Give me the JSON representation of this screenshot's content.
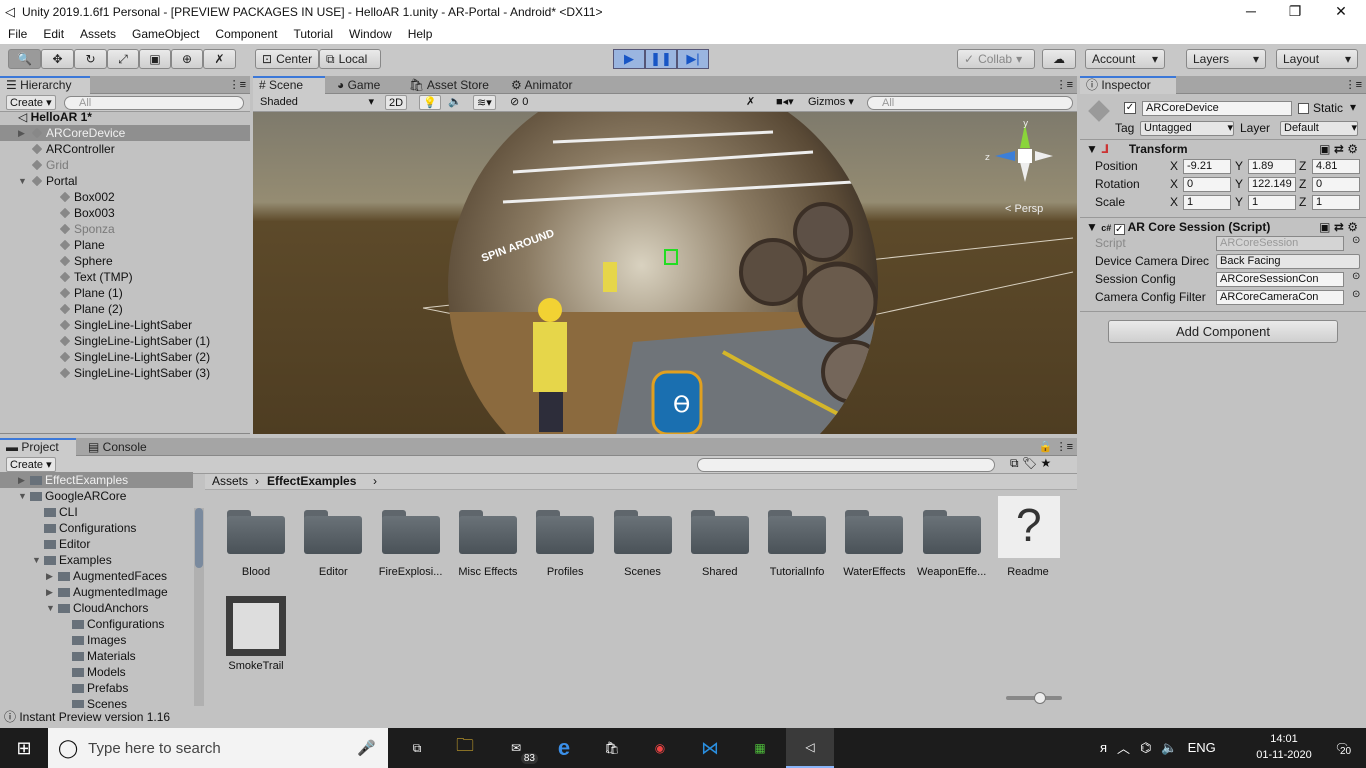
{
  "window": {
    "title": "Unity 2019.1.6f1 Personal - [PREVIEW PACKAGES IN USE] - HelloAR 1.unity - AR-Portal - Android* <DX11>"
  },
  "menu": [
    "File",
    "Edit",
    "Assets",
    "GameObject",
    "Component",
    "Tutorial",
    "Window",
    "Help"
  ],
  "toolbar": {
    "center": "Center",
    "local": "Local",
    "collab": "Collab",
    "account": "Account",
    "layers": "Layers",
    "layout": "Layout"
  },
  "hierarchy": {
    "tab": "Hierarchy",
    "create": "Create",
    "search_placeholder": "All",
    "scene": "HelloAR 1*",
    "items": [
      {
        "label": "ARCoreDevice",
        "level": 1,
        "selected": true
      },
      {
        "label": "ARController",
        "level": 1
      },
      {
        "label": "Grid",
        "level": 1,
        "dim": true
      },
      {
        "label": "Portal",
        "level": 1
      },
      {
        "label": "Box002",
        "level": 2
      },
      {
        "label": "Box003",
        "level": 2
      },
      {
        "label": "Sponza",
        "level": 2,
        "dim": true
      },
      {
        "label": "Plane",
        "level": 2
      },
      {
        "label": "Sphere",
        "level": 2
      },
      {
        "label": "Text (TMP)",
        "level": 2
      },
      {
        "label": "Plane (1)",
        "level": 2
      },
      {
        "label": "Plane (2)",
        "level": 2
      },
      {
        "label": "SingleLine-LightSaber",
        "level": 2
      },
      {
        "label": "SingleLine-LightSaber (1)",
        "level": 2
      },
      {
        "label": "SingleLine-LightSaber (2)",
        "level": 2
      },
      {
        "label": "SingleLine-LightSaber (3)",
        "level": 2
      }
    ]
  },
  "scene": {
    "tabs": [
      "Scene",
      "Game",
      "Asset Store",
      "Animator"
    ],
    "shading": "Shaded",
    "mode2d": "2D",
    "fx_count": "0",
    "gizmos": "Gizmos",
    "search_placeholder": "All",
    "persp": "Persp",
    "sign_text": "SPIN AROUND"
  },
  "inspector": {
    "tab": "Inspector",
    "object_name": "ARCoreDevice",
    "static": "Static",
    "tag_label": "Tag",
    "tag": "Untagged",
    "layer_label": "Layer",
    "layer": "Default",
    "transform": {
      "title": "Transform",
      "rows": [
        {
          "label": "Position",
          "x": "-9.21",
          "y": "1.89",
          "z": "4.81"
        },
        {
          "label": "Rotation",
          "x": "0",
          "y": "122.149",
          "z": "0"
        },
        {
          "label": "Scale",
          "x": "1",
          "y": "1",
          "z": "1"
        }
      ]
    },
    "script": {
      "title": "AR Core Session (Script)",
      "rows": [
        {
          "label": "Script",
          "value": "ARCoreSession"
        },
        {
          "label": "Device Camera Direc",
          "value": "Back Facing"
        },
        {
          "label": "Session Config",
          "value": "ARCoreSessionCon"
        },
        {
          "label": "Camera Config Filter",
          "value": "ARCoreCameraCon"
        }
      ]
    },
    "add_component": "Add Component"
  },
  "project": {
    "tabs": [
      "Project",
      "Console"
    ],
    "create": "Create",
    "tree": [
      {
        "label": "EffectExamples",
        "level": 1,
        "selected": true
      },
      {
        "label": "GoogleARCore",
        "level": 1
      },
      {
        "label": "CLI",
        "level": 2
      },
      {
        "label": "Configurations",
        "level": 2
      },
      {
        "label": "Editor",
        "level": 2
      },
      {
        "label": "Examples",
        "level": 2
      },
      {
        "label": "AugmentedFaces",
        "level": 3
      },
      {
        "label": "AugmentedImage",
        "level": 3
      },
      {
        "label": "CloudAnchors",
        "level": 3
      },
      {
        "label": "Configurations",
        "level": 4
      },
      {
        "label": "Images",
        "level": 4
      },
      {
        "label": "Materials",
        "level": 4
      },
      {
        "label": "Models",
        "level": 4
      },
      {
        "label": "Prefabs",
        "level": 4
      },
      {
        "label": "Scenes",
        "level": 4
      }
    ],
    "breadcrumb": [
      "Assets",
      "EffectExamples"
    ],
    "assets": [
      "Blood",
      "Editor",
      "FireExplosi...",
      "Misc Effects",
      "Profiles",
      "Scenes",
      "Shared",
      "TutorialInfo",
      "WaterEffects",
      "WeaponEffe..."
    ],
    "readme": "Readme",
    "smoke": "SmokeTrail"
  },
  "status": {
    "text": "Instant Preview version 1.16"
  },
  "taskbar": {
    "search_placeholder": "Type here to search",
    "mail_badge": "83",
    "lang": "ENG",
    "time": "14:01",
    "date": "01-11-2020",
    "notif": "20"
  }
}
